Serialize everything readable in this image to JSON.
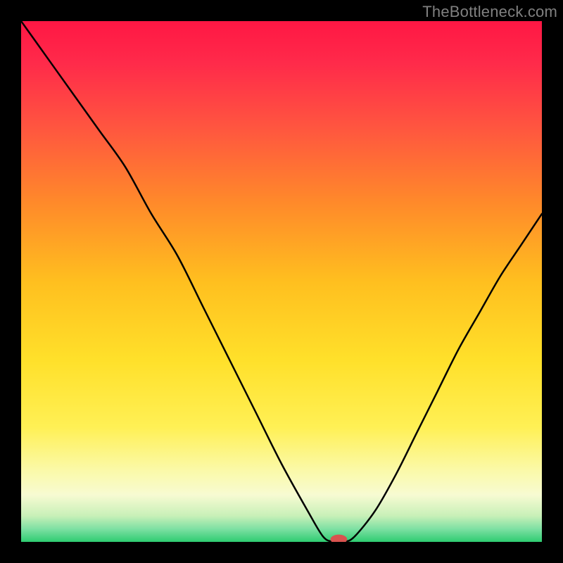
{
  "attribution": "TheBottleneck.com",
  "chart_data": {
    "type": "line",
    "title": "",
    "xlabel": "",
    "ylabel": "",
    "xlim": [
      0,
      100
    ],
    "ylim": [
      0,
      100
    ],
    "x": [
      0,
      5,
      10,
      15,
      20,
      25,
      30,
      35,
      40,
      45,
      50,
      55,
      58,
      60,
      62,
      64,
      68,
      72,
      76,
      80,
      84,
      88,
      92,
      96,
      100
    ],
    "values": [
      100,
      93,
      86,
      79,
      72,
      63,
      55,
      45,
      35,
      25,
      15,
      6,
      1,
      0,
      0,
      1,
      6,
      13,
      21,
      29,
      37,
      44,
      51,
      57,
      63
    ],
    "marker": {
      "x": 61,
      "y": 0.5,
      "rx": 1.6,
      "ry": 0.9,
      "color": "#d9534f"
    },
    "gradient_stops": [
      {
        "offset": 0.0,
        "color": "#ff1744"
      },
      {
        "offset": 0.08,
        "color": "#ff2a4a"
      },
      {
        "offset": 0.2,
        "color": "#ff5440"
      },
      {
        "offset": 0.35,
        "color": "#ff8a2a"
      },
      {
        "offset": 0.5,
        "color": "#ffbf1f"
      },
      {
        "offset": 0.65,
        "color": "#ffe02a"
      },
      {
        "offset": 0.78,
        "color": "#fff055"
      },
      {
        "offset": 0.86,
        "color": "#fbf9a6"
      },
      {
        "offset": 0.91,
        "color": "#f7fbd2"
      },
      {
        "offset": 0.95,
        "color": "#c8f0b8"
      },
      {
        "offset": 0.975,
        "color": "#7ee0a3"
      },
      {
        "offset": 1.0,
        "color": "#2ecc71"
      }
    ]
  }
}
